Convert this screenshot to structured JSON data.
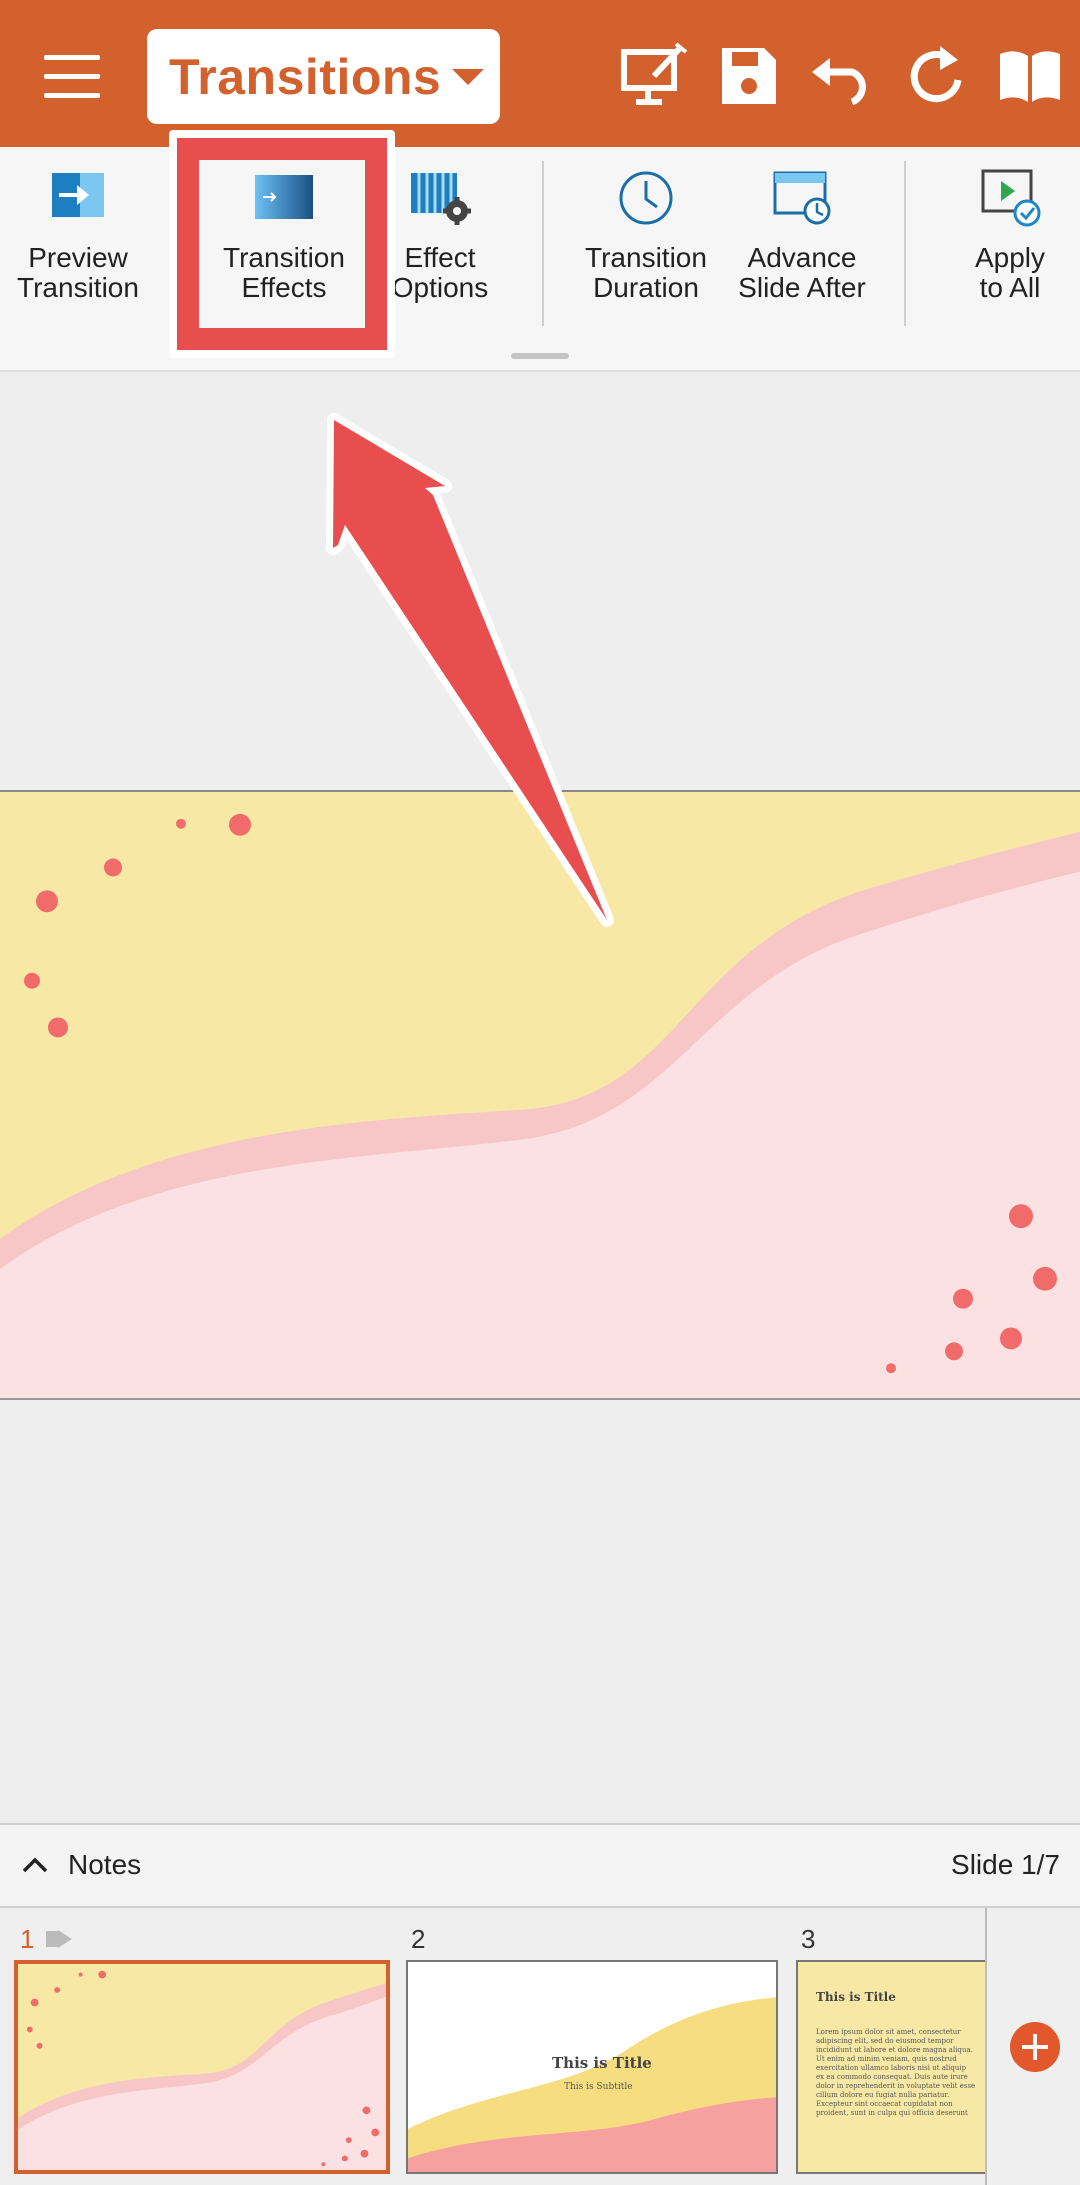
{
  "toolbar": {
    "mode_label": "Transitions",
    "icons": [
      "menu-icon",
      "present-edit-icon",
      "save-icon",
      "undo-icon",
      "redo-icon",
      "reading-view-icon"
    ]
  },
  "ribbon": {
    "items": [
      {
        "label_line1": "Preview",
        "label_line2": "Transition",
        "icon": "preview-transition-icon"
      },
      {
        "label_line1": "Transition",
        "label_line2": "Effects",
        "icon": "transition-effects-icon"
      },
      {
        "label_line1": "Effect",
        "label_line2": "Options",
        "icon": "effect-options-icon"
      },
      {
        "label_line1": "Transition",
        "label_line2": "Duration",
        "icon": "clock-icon"
      },
      {
        "label_line1": "Advance",
        "label_line2": "Slide After",
        "icon": "advance-slide-icon"
      },
      {
        "label_line1": "Apply",
        "label_line2": "to All",
        "icon": "apply-to-all-icon"
      }
    ],
    "highlighted_item": "Transition Effects"
  },
  "notes": {
    "label": "Notes",
    "slide_counter": "Slide 1/7"
  },
  "thumbnails": [
    {
      "number": "1",
      "active": true
    },
    {
      "number": "2",
      "active": false,
      "title": "This is Title",
      "subtitle": "This is Subtitle"
    },
    {
      "number": "3",
      "active": false,
      "title": "This is Title",
      "body": "Lorem ipsum dolor sit amet, consectetur adipiscing elit, sed do eiusmod tempor incididunt ut labore et dolore magna aliqua. Ut enim ad minim veniam, quis nostrud exercitation ullamco laboris nisi ut aliquip ex ea commodo consequat. Duis aute irure dolor in reprehenderit in voluptate velit esse cillum dolore eu fugiat nulla pariatur. Excepteur sint occaecat cupidatat non proident, sunt in culpa qui officia deserunt mollit anim id est laborum."
    }
  ],
  "colors": {
    "accent": "#d2612d",
    "highlight": "#e84e4e",
    "slide_yellow": "#f7e8a6",
    "slide_pink": "#fbe1e2",
    "dot": "#f26b6b"
  }
}
